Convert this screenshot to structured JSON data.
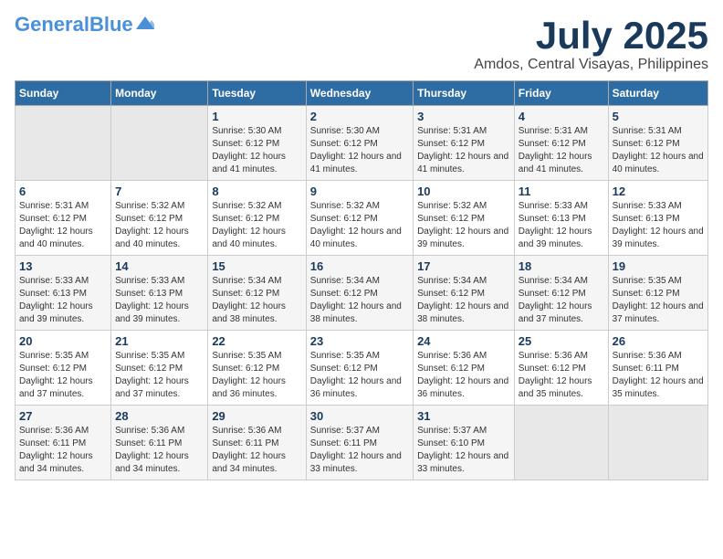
{
  "header": {
    "logo_general": "General",
    "logo_blue": "Blue",
    "main_title": "July 2025",
    "subtitle": "Amdos, Central Visayas, Philippines"
  },
  "days_of_week": [
    "Sunday",
    "Monday",
    "Tuesday",
    "Wednesday",
    "Thursday",
    "Friday",
    "Saturday"
  ],
  "weeks": [
    {
      "days": [
        {
          "date": "",
          "sunrise": "",
          "sunset": "",
          "daylight": ""
        },
        {
          "date": "",
          "sunrise": "",
          "sunset": "",
          "daylight": ""
        },
        {
          "date": "1",
          "sunrise": "Sunrise: 5:30 AM",
          "sunset": "Sunset: 6:12 PM",
          "daylight": "Daylight: 12 hours and 41 minutes."
        },
        {
          "date": "2",
          "sunrise": "Sunrise: 5:30 AM",
          "sunset": "Sunset: 6:12 PM",
          "daylight": "Daylight: 12 hours and 41 minutes."
        },
        {
          "date": "3",
          "sunrise": "Sunrise: 5:31 AM",
          "sunset": "Sunset: 6:12 PM",
          "daylight": "Daylight: 12 hours and 41 minutes."
        },
        {
          "date": "4",
          "sunrise": "Sunrise: 5:31 AM",
          "sunset": "Sunset: 6:12 PM",
          "daylight": "Daylight: 12 hours and 41 minutes."
        },
        {
          "date": "5",
          "sunrise": "Sunrise: 5:31 AM",
          "sunset": "Sunset: 6:12 PM",
          "daylight": "Daylight: 12 hours and 40 minutes."
        }
      ]
    },
    {
      "days": [
        {
          "date": "6",
          "sunrise": "Sunrise: 5:31 AM",
          "sunset": "Sunset: 6:12 PM",
          "daylight": "Daylight: 12 hours and 40 minutes."
        },
        {
          "date": "7",
          "sunrise": "Sunrise: 5:32 AM",
          "sunset": "Sunset: 6:12 PM",
          "daylight": "Daylight: 12 hours and 40 minutes."
        },
        {
          "date": "8",
          "sunrise": "Sunrise: 5:32 AM",
          "sunset": "Sunset: 6:12 PM",
          "daylight": "Daylight: 12 hours and 40 minutes."
        },
        {
          "date": "9",
          "sunrise": "Sunrise: 5:32 AM",
          "sunset": "Sunset: 6:12 PM",
          "daylight": "Daylight: 12 hours and 40 minutes."
        },
        {
          "date": "10",
          "sunrise": "Sunrise: 5:32 AM",
          "sunset": "Sunset: 6:12 PM",
          "daylight": "Daylight: 12 hours and 39 minutes."
        },
        {
          "date": "11",
          "sunrise": "Sunrise: 5:33 AM",
          "sunset": "Sunset: 6:13 PM",
          "daylight": "Daylight: 12 hours and 39 minutes."
        },
        {
          "date": "12",
          "sunrise": "Sunrise: 5:33 AM",
          "sunset": "Sunset: 6:13 PM",
          "daylight": "Daylight: 12 hours and 39 minutes."
        }
      ]
    },
    {
      "days": [
        {
          "date": "13",
          "sunrise": "Sunrise: 5:33 AM",
          "sunset": "Sunset: 6:13 PM",
          "daylight": "Daylight: 12 hours and 39 minutes."
        },
        {
          "date": "14",
          "sunrise": "Sunrise: 5:33 AM",
          "sunset": "Sunset: 6:13 PM",
          "daylight": "Daylight: 12 hours and 39 minutes."
        },
        {
          "date": "15",
          "sunrise": "Sunrise: 5:34 AM",
          "sunset": "Sunset: 6:12 PM",
          "daylight": "Daylight: 12 hours and 38 minutes."
        },
        {
          "date": "16",
          "sunrise": "Sunrise: 5:34 AM",
          "sunset": "Sunset: 6:12 PM",
          "daylight": "Daylight: 12 hours and 38 minutes."
        },
        {
          "date": "17",
          "sunrise": "Sunrise: 5:34 AM",
          "sunset": "Sunset: 6:12 PM",
          "daylight": "Daylight: 12 hours and 38 minutes."
        },
        {
          "date": "18",
          "sunrise": "Sunrise: 5:34 AM",
          "sunset": "Sunset: 6:12 PM",
          "daylight": "Daylight: 12 hours and 37 minutes."
        },
        {
          "date": "19",
          "sunrise": "Sunrise: 5:35 AM",
          "sunset": "Sunset: 6:12 PM",
          "daylight": "Daylight: 12 hours and 37 minutes."
        }
      ]
    },
    {
      "days": [
        {
          "date": "20",
          "sunrise": "Sunrise: 5:35 AM",
          "sunset": "Sunset: 6:12 PM",
          "daylight": "Daylight: 12 hours and 37 minutes."
        },
        {
          "date": "21",
          "sunrise": "Sunrise: 5:35 AM",
          "sunset": "Sunset: 6:12 PM",
          "daylight": "Daylight: 12 hours and 37 minutes."
        },
        {
          "date": "22",
          "sunrise": "Sunrise: 5:35 AM",
          "sunset": "Sunset: 6:12 PM",
          "daylight": "Daylight: 12 hours and 36 minutes."
        },
        {
          "date": "23",
          "sunrise": "Sunrise: 5:35 AM",
          "sunset": "Sunset: 6:12 PM",
          "daylight": "Daylight: 12 hours and 36 minutes."
        },
        {
          "date": "24",
          "sunrise": "Sunrise: 5:36 AM",
          "sunset": "Sunset: 6:12 PM",
          "daylight": "Daylight: 12 hours and 36 minutes."
        },
        {
          "date": "25",
          "sunrise": "Sunrise: 5:36 AM",
          "sunset": "Sunset: 6:12 PM",
          "daylight": "Daylight: 12 hours and 35 minutes."
        },
        {
          "date": "26",
          "sunrise": "Sunrise: 5:36 AM",
          "sunset": "Sunset: 6:11 PM",
          "daylight": "Daylight: 12 hours and 35 minutes."
        }
      ]
    },
    {
      "days": [
        {
          "date": "27",
          "sunrise": "Sunrise: 5:36 AM",
          "sunset": "Sunset: 6:11 PM",
          "daylight": "Daylight: 12 hours and 34 minutes."
        },
        {
          "date": "28",
          "sunrise": "Sunrise: 5:36 AM",
          "sunset": "Sunset: 6:11 PM",
          "daylight": "Daylight: 12 hours and 34 minutes."
        },
        {
          "date": "29",
          "sunrise": "Sunrise: 5:36 AM",
          "sunset": "Sunset: 6:11 PM",
          "daylight": "Daylight: 12 hours and 34 minutes."
        },
        {
          "date": "30",
          "sunrise": "Sunrise: 5:37 AM",
          "sunset": "Sunset: 6:11 PM",
          "daylight": "Daylight: 12 hours and 33 minutes."
        },
        {
          "date": "31",
          "sunrise": "Sunrise: 5:37 AM",
          "sunset": "Sunset: 6:10 PM",
          "daylight": "Daylight: 12 hours and 33 minutes."
        },
        {
          "date": "",
          "sunrise": "",
          "sunset": "",
          "daylight": ""
        },
        {
          "date": "",
          "sunrise": "",
          "sunset": "",
          "daylight": ""
        }
      ]
    }
  ]
}
